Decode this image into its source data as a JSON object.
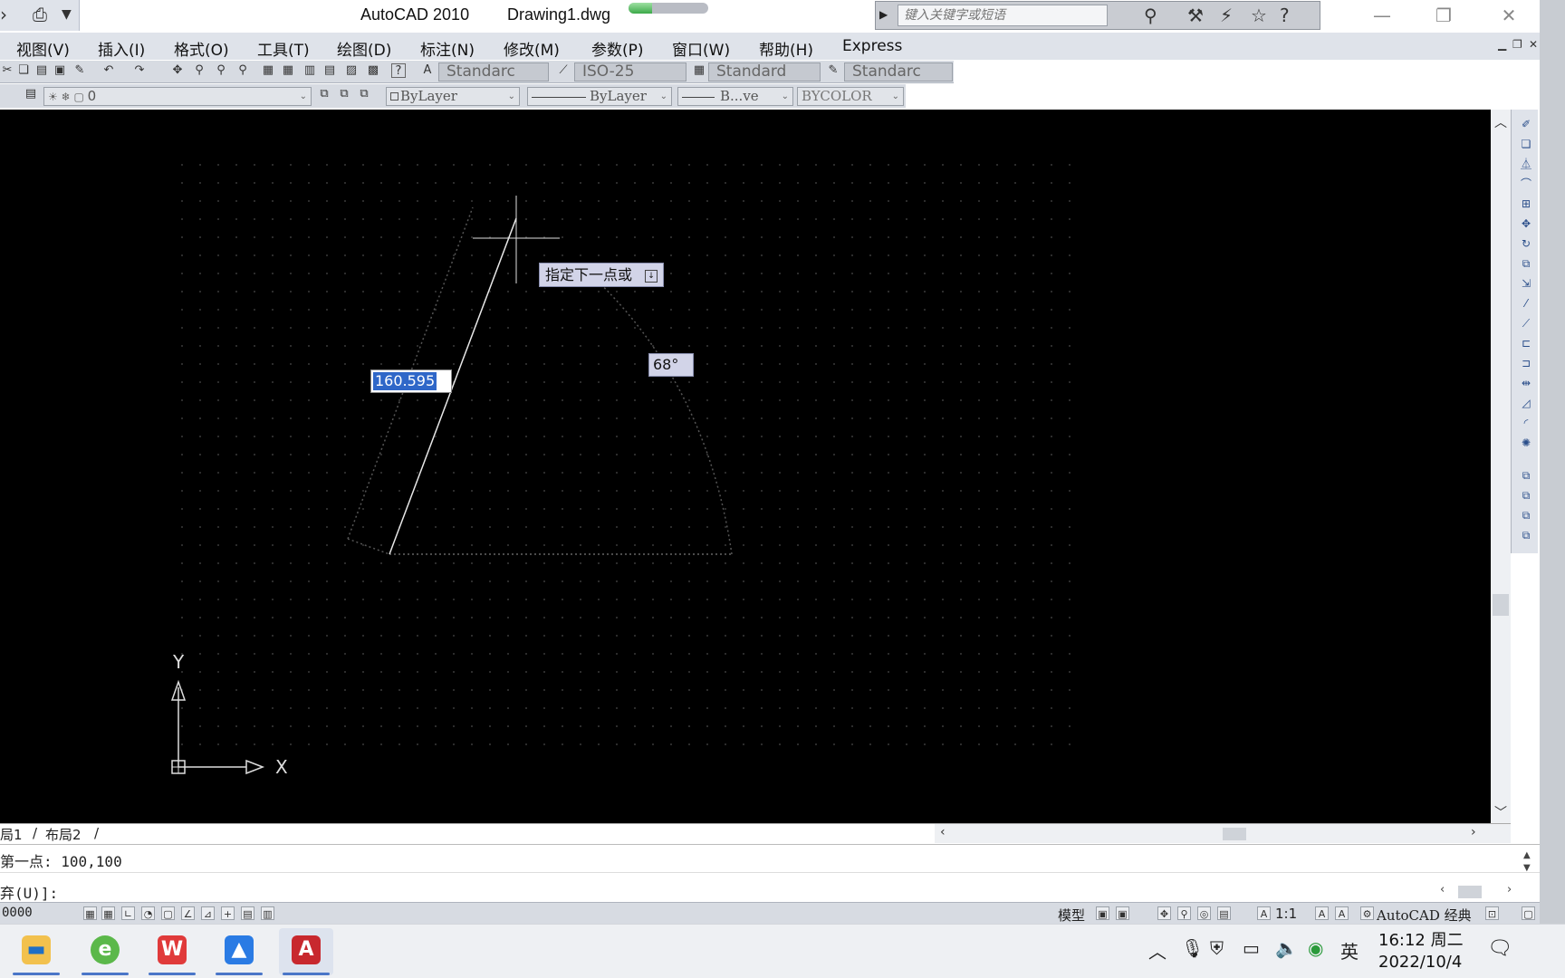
{
  "titlebar": {
    "app": "AutoCAD 2010",
    "document": "Drawing1.dwg",
    "search_placeholder": "键入关键字或短语",
    "progress_fraction": 0.3
  },
  "menu": [
    "视图(V)",
    "插入(I)",
    "格式(O)",
    "工具(T)",
    "绘图(D)",
    "标注(N)",
    "修改(M)",
    "参数(P)",
    "窗口(W)",
    "帮助(H)",
    "Express"
  ],
  "toolbar": {
    "text_style": "Standarc",
    "dim_style": "ISO-25",
    "table_style": "Standard",
    "mleader_style": "Standarc"
  },
  "layers": {
    "current_layer": "0",
    "color": "ByLayer",
    "linetype": "ByLayer",
    "lineweight": "B...ve",
    "plotstyle": "BYCOLOR"
  },
  "canvas": {
    "tooltip": "指定下一点或",
    "length_value": "160.595",
    "angle_value": "68°",
    "ucs_x": "X",
    "ucs_y": "Y"
  },
  "layout_tabs": [
    "局1",
    "布局2"
  ],
  "command": {
    "line1": "第一点: 100,100",
    "line2": "弃(U)]:"
  },
  "statusbar": {
    "coords": "0000",
    "model": "模型",
    "scale": "1:1",
    "workspace": "AutoCAD 经典"
  },
  "taskbar": {
    "ime": "英",
    "time": "16:12 周二",
    "date": "2022/10/4"
  },
  "colors": {
    "canvas_bg": "#000000",
    "tooltip_bg": "#d2d4e8",
    "selection": "#2f67c8"
  }
}
